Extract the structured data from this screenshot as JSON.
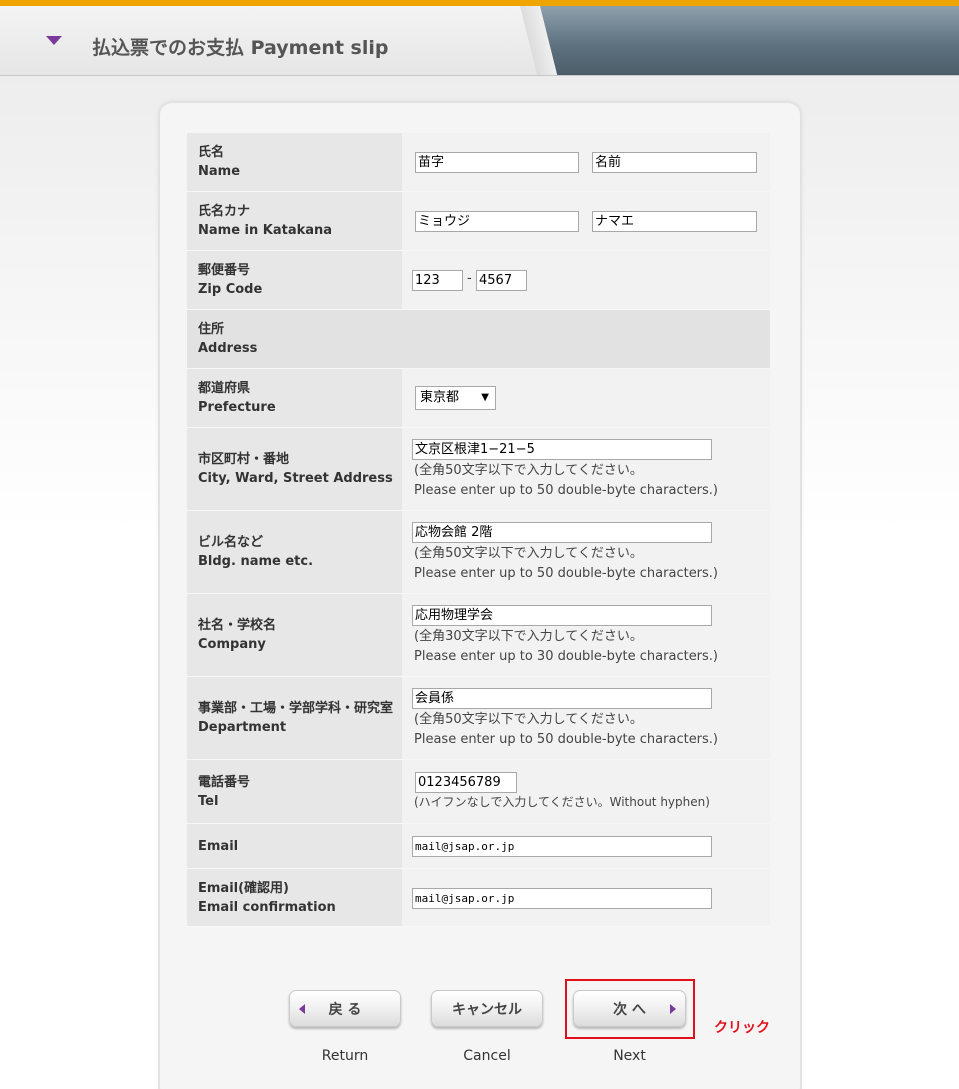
{
  "header": {
    "title": "払込票でのお支払  Payment slip"
  },
  "form": {
    "name": {
      "label_ja": "氏名",
      "label_en": "Name",
      "last": "苗字",
      "first": "名前"
    },
    "kana": {
      "label_ja": "氏名カナ",
      "label_en": "Name in Katakana",
      "last": "ミョウジ",
      "first": "ナマエ"
    },
    "zip": {
      "label_ja": "郵便番号",
      "label_en": "Zip Code",
      "part1": "123",
      "sep": "-",
      "part2": "4567"
    },
    "address": {
      "label_ja": "住所",
      "label_en": "Address"
    },
    "prefecture": {
      "label_ja": "都道府県",
      "label_en": "Prefecture",
      "value": "東京都",
      "arrow": "▼"
    },
    "city": {
      "label_ja": "市区町村・番地",
      "label_en": "City, Ward, Street Address",
      "value": "文京区根津1−21−5",
      "note_ja": "(全角50文字以下で入力してください。",
      "note_en": "Please enter up to 50 double-byte characters.)"
    },
    "bldg": {
      "label_ja": "ビル名など",
      "label_en": "Bldg. name etc.",
      "value": "応物会館 2階",
      "note_ja": "(全角50文字以下で入力してください。",
      "note_en": "Please enter up to 50 double-byte characters.)"
    },
    "company": {
      "label_ja": "社名・学校名",
      "label_en": "Company",
      "value": "応用物理学会",
      "note_ja": "(全角30文字以下で入力してください。",
      "note_en": "Please enter up to 30 double-byte characters.)"
    },
    "department": {
      "label_ja": "事業部・工場・学部学科・研究室",
      "label_en": "Department",
      "value": "会員係",
      "note_ja": "(全角50文字以下で入力してください。",
      "note_en": "Please enter up to 50 double-byte characters.)"
    },
    "tel": {
      "label_ja": "電話番号",
      "label_en": "Tel",
      "value": "0123456789",
      "note": "(ハイフンなしで入力してください。Without hyphen)"
    },
    "email": {
      "label_en": "Email",
      "value": "mail@jsap.or.jp"
    },
    "email_confirm": {
      "label_ja": "Email(確認用)",
      "label_en": "Email confirmation",
      "value": "mail@jsap.or.jp"
    }
  },
  "buttons": {
    "back": {
      "label": "戻 る",
      "caption": "Return"
    },
    "cancel": {
      "label": "キャンセル",
      "caption": "Cancel"
    },
    "next": {
      "label": "次 へ",
      "caption": "Next"
    }
  },
  "annotation": {
    "click": "クリック",
    "color": "#e0101a"
  },
  "colors": {
    "accent_top": "#f0a400",
    "arrow": "#7a3a9a"
  }
}
